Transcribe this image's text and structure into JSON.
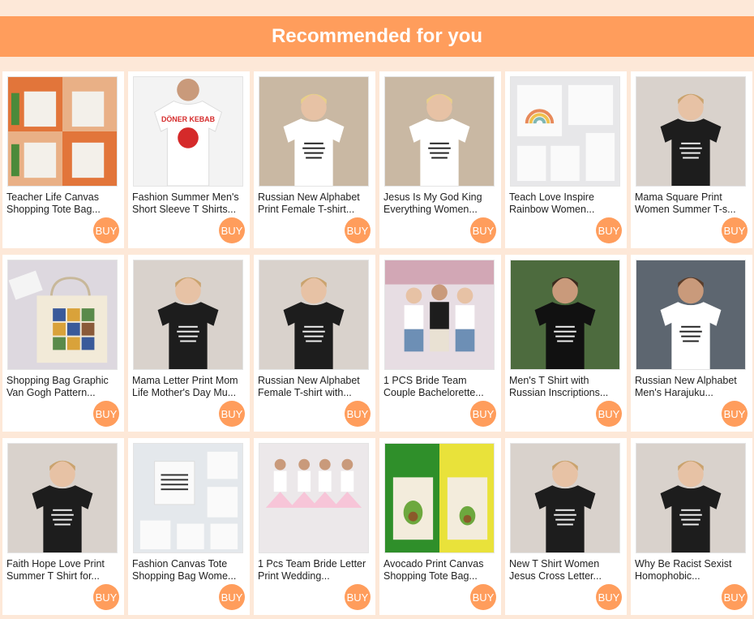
{
  "header": {
    "title": "Recommended for you"
  },
  "buy_label": "BUY",
  "colors": {
    "accent": "#ff9d5c",
    "background": "#fde8d8",
    "card": "#ffffff"
  },
  "products": [
    {
      "title": "Teacher Life Canvas Shopping Tote Bag...",
      "image": "tote-bags-grid",
      "image_text": ""
    },
    {
      "title": "Fashion Summer Men's Short Sleeve T Shirts...",
      "image": "white-tshirt-red-print",
      "image_text": "DÖNER KEBAB"
    },
    {
      "title": "Russian New Alphabet Print Female T-shirt...",
      "image": "white-tshirt-woman",
      "image_text": ""
    },
    {
      "title": "Jesus Is My God King Everything Women...",
      "image": "white-tshirt-woman",
      "image_text": "JESUS"
    },
    {
      "title": "Teach Love Inspire Rainbow Women...",
      "image": "rainbow-totes",
      "image_text": ""
    },
    {
      "title": "Mama Square Print Women Summer T-s...",
      "image": "black-tshirt-woman",
      "image_text": "MA MA"
    },
    {
      "title": "Shopping Bag Graphic Van Gogh Pattern...",
      "image": "art-tote",
      "image_text": ""
    },
    {
      "title": "Mama Letter Print Mom Life Mother's Day Mu...",
      "image": "black-tshirt-woman",
      "image_text": ""
    },
    {
      "title": "Russian New Alphabet Female T-shirt with...",
      "image": "black-tshirt-woman",
      "image_text": ""
    },
    {
      "title": "1 PCS Bride Team Couple Bachelorette...",
      "image": "bride-group",
      "image_text": ""
    },
    {
      "title": "Men's T Shirt with Russian Inscriptions...",
      "image": "black-tshirt-man",
      "image_text": ""
    },
    {
      "title": "Russian New Alphabet Men's Harajuku...",
      "image": "white-tshirt-man",
      "image_text": ""
    },
    {
      "title": "Faith Hope Love Print Summer T Shirt for...",
      "image": "black-tshirt-woman",
      "image_text": ""
    },
    {
      "title": "Fashion Canvas Tote Shopping Bag Wome...",
      "image": "text-totes",
      "image_text": ""
    },
    {
      "title": "1 Pcs Team Bride Letter Print Wedding...",
      "image": "bride-group-pink",
      "image_text": ""
    },
    {
      "title": "Avocado Print Canvas Shopping Tote Bag...",
      "image": "avocado-totes",
      "image_text": ""
    },
    {
      "title": "New T Shirt Women Jesus Cross Letter...",
      "image": "black-tshirt-woman",
      "image_text": ""
    },
    {
      "title": "Why Be Racist Sexist Homophobic...",
      "image": "black-tshirt-woman",
      "image_text": ""
    }
  ]
}
